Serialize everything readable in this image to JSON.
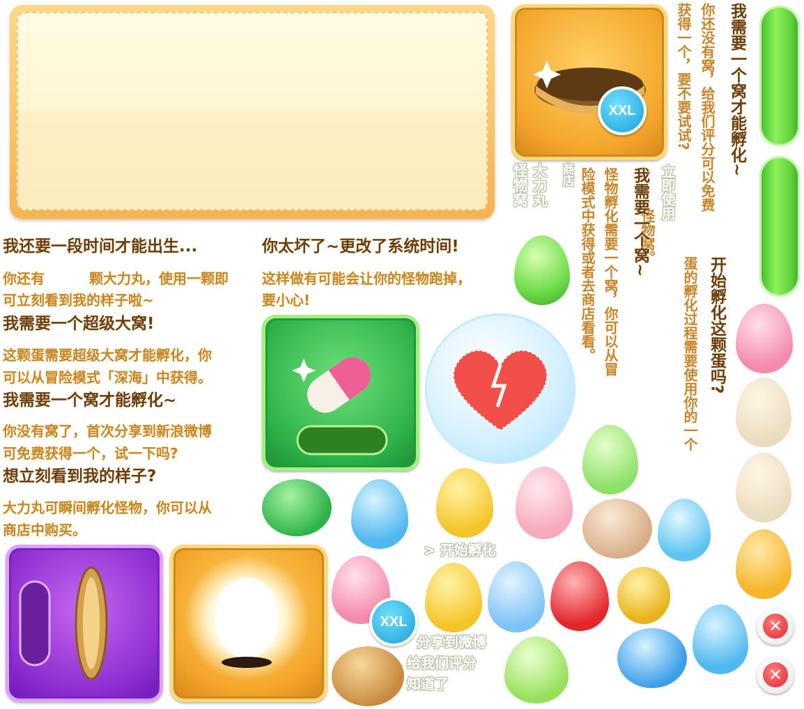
{
  "texts": {
    "need_time": "我还要一段时间才能出生...",
    "pills_left_a": "你还有",
    "pills_left_b": "颗大力丸，使用一颗即",
    "pills_left_c": "可立刻看到我的样子啦~",
    "need_super_nest": "我需要一个超级大窝!",
    "super_nest_desc_1": "这颗蛋需要超级大窝才能孵化，你",
    "super_nest_desc_2": "可以从冒险模式「深海」中获得。",
    "need_nest_hatch": "我需要一个窝才能孵化~",
    "no_nest_share_1": "你没有窝了，首次分享到新浪微博",
    "no_nest_share_2": "可免费获得一个，试一下吗?",
    "want_see": "想立刻看到我的样子?",
    "pill_desc_1": "大力丸可瞬间孵化怪物，你可以从",
    "pill_desc_2": "商店中购买。",
    "too_bad": "你太坏了~更改了系统时间!",
    "run_away_1": "这样做有可能会让你的怪物跑掉，",
    "run_away_2": "要小心!",
    "pill_name": "大力丸",
    "monster_nest": "怪物窝",
    "shop": "商店",
    "v_need_nest_title": "我需要一个窝才能孵化~",
    "v_no_nest_1": "你还没有窝，给我们评分可以免费",
    "v_no_nest_2": "获得一个，要不要试试?",
    "v_use_now": "立即使用",
    "v_monster_nest": "怪物窝。",
    "v_need_one": "我需要一个窝~",
    "v_hatch_need_1": "怪物孵化需要一个窝，你可以从冒",
    "v_hatch_need_2": "险模式中获得或者去商店看看。",
    "v_start_q": "开始孵化这颗蛋吗?",
    "v_process": "蛋的孵化过程需要使用你的一个",
    "start_hatch": "> 开始孵化",
    "share_weibo": "分享到微博",
    "rate_us": "给我们评分",
    "got_it": "知道了",
    "xxl": "XXL",
    "xxl2": "XXL"
  },
  "icons": [
    "nest-basket-icon",
    "pill-icon",
    "broken-heart-icon",
    "golden-nest-icon",
    "glowing-egg-icon",
    "close-icon"
  ],
  "colors": {
    "brown": "#7a4a16",
    "orange": "#c88426",
    "green": "#5cd13b",
    "gold": "#f3a62a"
  }
}
